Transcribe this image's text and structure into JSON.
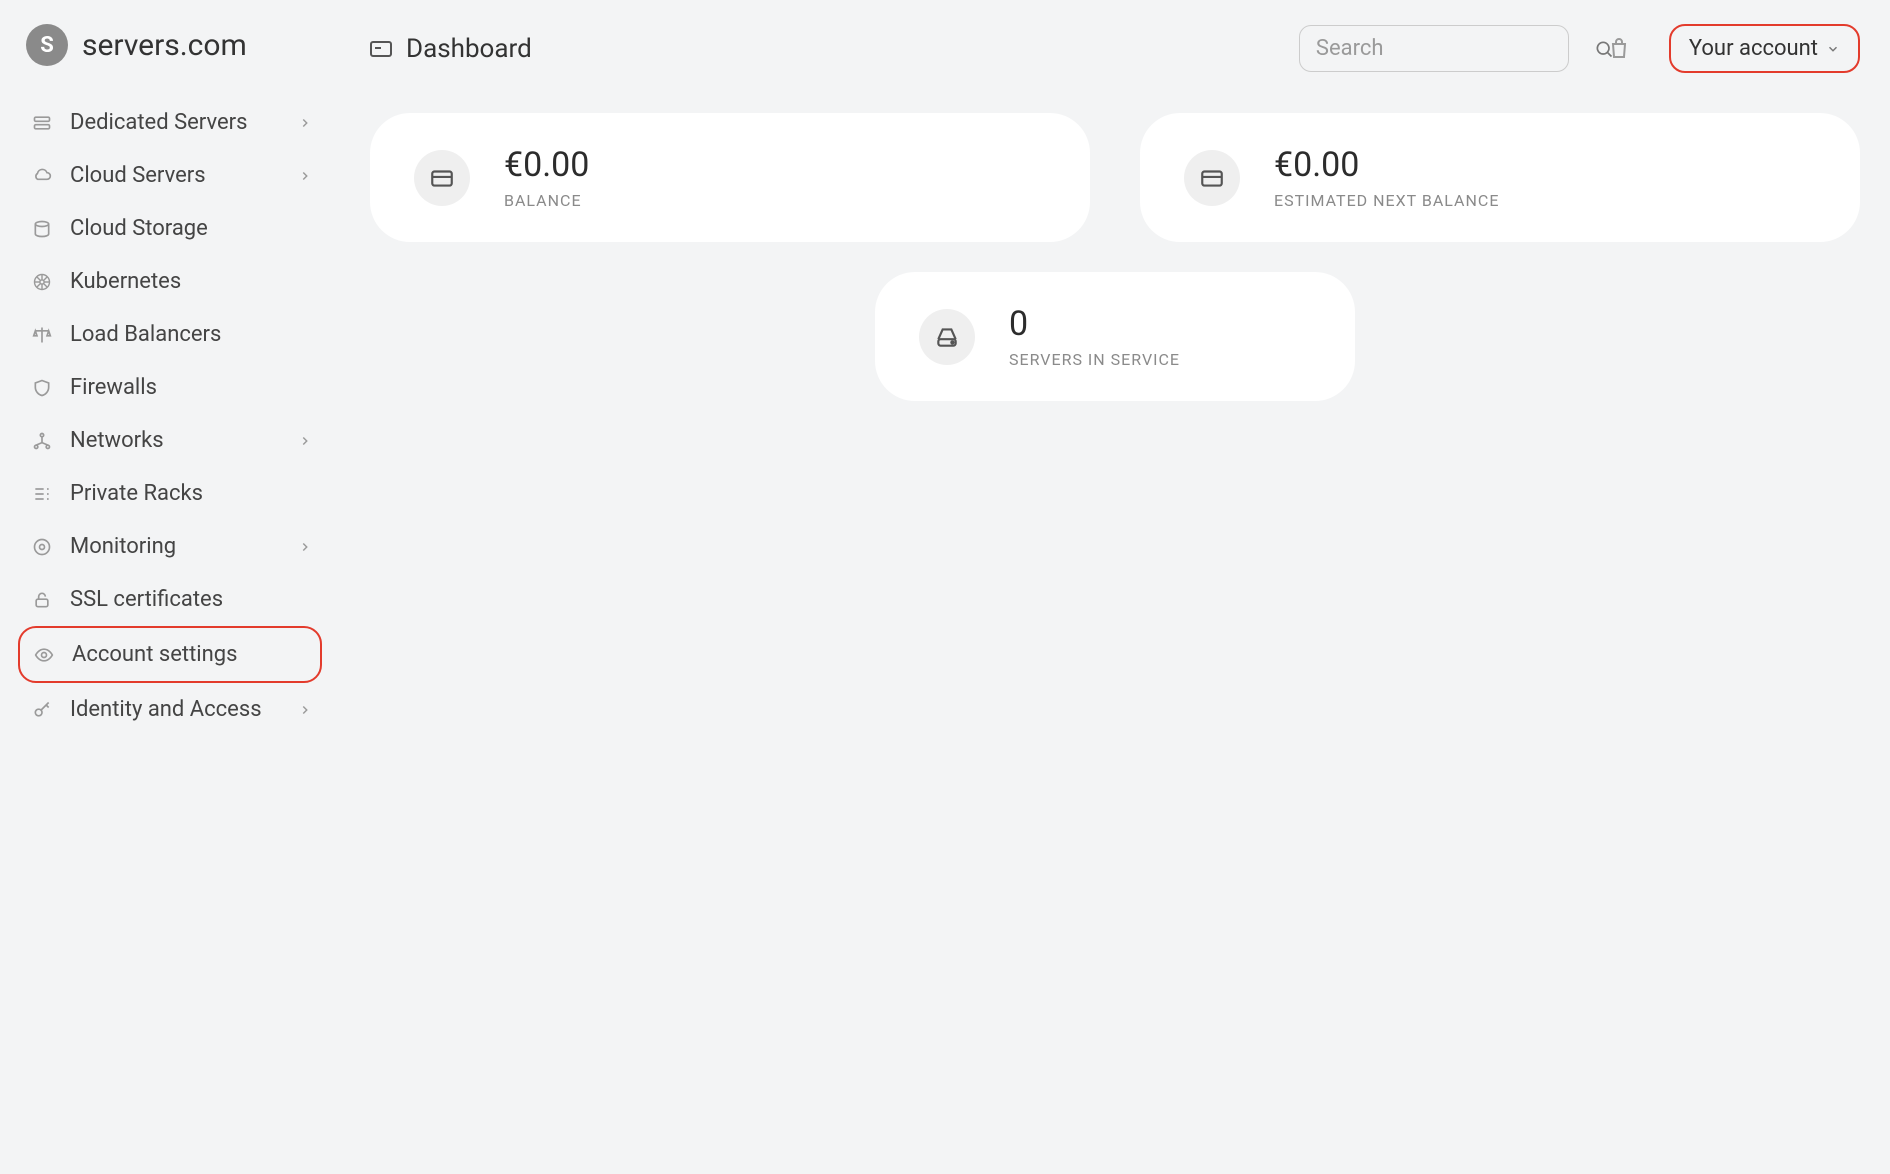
{
  "brand": {
    "name": "servers.com",
    "mark": "S"
  },
  "sidebar": {
    "items": [
      {
        "label": "Dedicated Servers",
        "icon": "server-icon",
        "expandable": true,
        "highlight": false
      },
      {
        "label": "Cloud Servers",
        "icon": "cloud-icon",
        "expandable": true,
        "highlight": false
      },
      {
        "label": "Cloud Storage",
        "icon": "storage-icon",
        "expandable": false,
        "highlight": false
      },
      {
        "label": "Kubernetes",
        "icon": "kubernetes-icon",
        "expandable": false,
        "highlight": false
      },
      {
        "label": "Load Balancers",
        "icon": "balance-icon",
        "expandable": false,
        "highlight": false
      },
      {
        "label": "Firewalls",
        "icon": "shield-icon",
        "expandable": false,
        "highlight": false
      },
      {
        "label": "Networks",
        "icon": "network-icon",
        "expandable": true,
        "highlight": false
      },
      {
        "label": "Private Racks",
        "icon": "racks-icon",
        "expandable": false,
        "highlight": false
      },
      {
        "label": "Monitoring",
        "icon": "monitoring-icon",
        "expandable": true,
        "highlight": false
      },
      {
        "label": "SSL certificates",
        "icon": "lock-icon",
        "expandable": false,
        "highlight": false
      },
      {
        "label": "Account settings",
        "icon": "eye-icon",
        "expandable": false,
        "highlight": true
      },
      {
        "label": "Identity and Access",
        "icon": "key-icon",
        "expandable": true,
        "highlight": false
      }
    ]
  },
  "header": {
    "breadcrumb": "Dashboard",
    "search_placeholder": "Search",
    "account_label": "Your account"
  },
  "cards": {
    "balance": {
      "value": "€0.00",
      "label": "BALANCE"
    },
    "estimated": {
      "value": "€0.00",
      "label": "ESTIMATED NEXT BALANCE"
    },
    "servers": {
      "value": "0",
      "label": "SERVERS IN SERVICE"
    }
  }
}
